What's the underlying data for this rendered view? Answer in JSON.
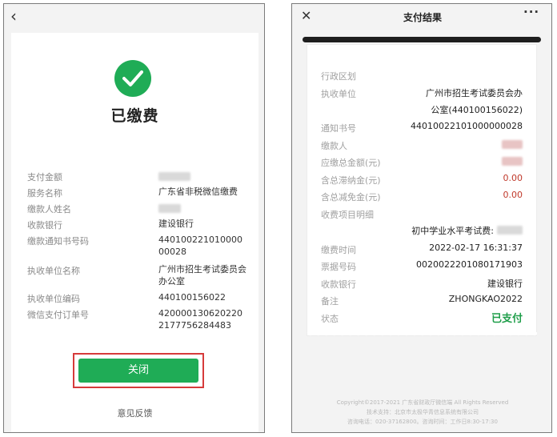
{
  "left_screen": {
    "back_icon": "‹",
    "status_title": "已缴费",
    "rows": [
      {
        "label": "支付金额",
        "value": ""
      },
      {
        "label": "服务名称",
        "value": "广东省非税微信缴费"
      },
      {
        "label": "缴款人姓名",
        "value": ""
      },
      {
        "label": "收款银行",
        "value": "建设银行"
      },
      {
        "label": "缴款通知书号码",
        "value": "44010022101000000028"
      },
      {
        "label": "执收单位名称",
        "value": "广州市招生考试委员会办公室"
      },
      {
        "label": "执收单位编码",
        "value": "440100156022"
      },
      {
        "label": "微信支付订单号",
        "value": "4200001306202202177756284483"
      }
    ],
    "close_button": "关闭",
    "feedback_link": "意见反馈"
  },
  "right_screen": {
    "close_icon": "✕",
    "title": "支付结果",
    "more_icon": "···",
    "rows": [
      {
        "label": "行政区划",
        "value": ""
      },
      {
        "label": "执收单位",
        "value": "广州市招生考试委员会办"
      },
      {
        "label": "",
        "value": "公室(440100156022)"
      },
      {
        "label": "通知书号",
        "value": "44010022101000000028"
      },
      {
        "label": "缴款人",
        "value": ""
      },
      {
        "label": "应缴总金额(元)",
        "value": ""
      },
      {
        "label": "含总滞纳金(元)",
        "value": "0.00"
      },
      {
        "label": "含总减免金(元)",
        "value": "0.00"
      },
      {
        "label": "收费项目明细",
        "value": ""
      },
      {
        "label": "",
        "value": "初中学业水平考试费:"
      },
      {
        "label": "缴费时间",
        "value": "2022-02-17 16:31:37"
      },
      {
        "label": "票据号码",
        "value": "0020022201080171903"
      },
      {
        "label": "收款银行",
        "value": "建设银行"
      },
      {
        "label": "备注",
        "value": "ZHONGKAO2022"
      },
      {
        "label": "状态",
        "value": "已支付"
      }
    ],
    "footer": {
      "line1": "Copyright©2017-2021 广东省财政厅微信端 All Rights Reserved",
      "line2": "技术支持：北京市太极华青信息系统有限公司",
      "line3": "咨询电话：020-37162800。咨询时间：工作日8:30-17:30"
    }
  },
  "colors": {
    "green": "#1fac56",
    "highlight_frame": "#d63b3b",
    "red_value": "#c0392b",
    "status_green": "#1f9e4a"
  }
}
